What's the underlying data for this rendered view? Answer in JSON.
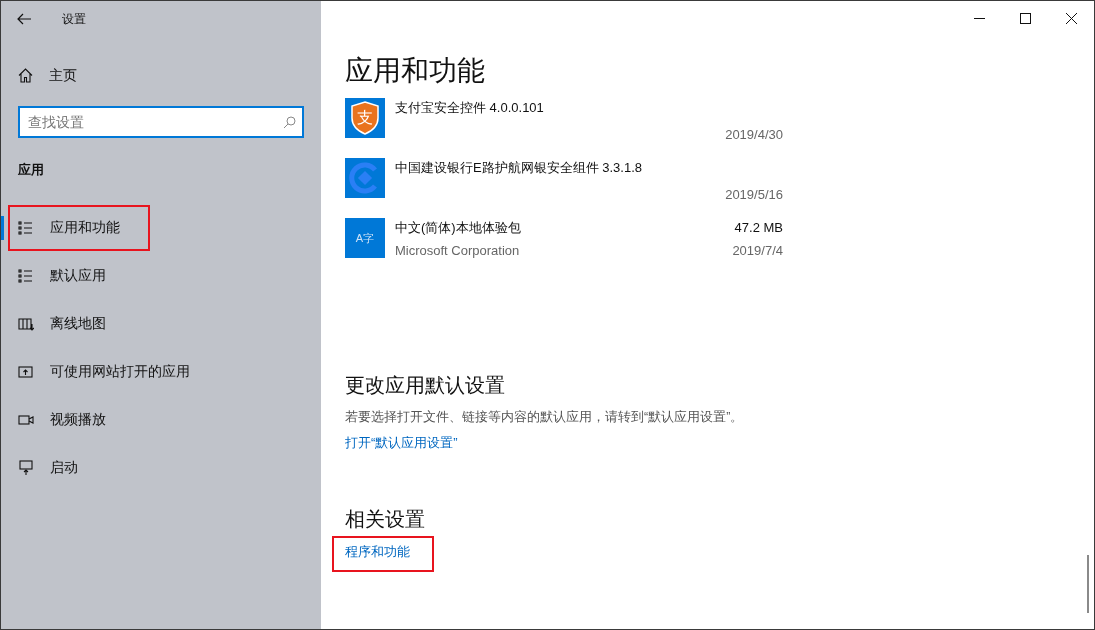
{
  "window": {
    "title": "设置"
  },
  "sidebar": {
    "home": "主页",
    "search": {
      "placeholder": "查找设置"
    },
    "section": "应用",
    "items": [
      {
        "label": "应用和功能",
        "selected": true,
        "annotated": true
      },
      {
        "label": "默认应用",
        "selected": false,
        "annotated": false
      },
      {
        "label": "离线地图",
        "selected": false,
        "annotated": false
      },
      {
        "label": "可使用网站打开的应用",
        "selected": false,
        "annotated": false
      },
      {
        "label": "视频播放",
        "selected": false,
        "annotated": false
      },
      {
        "label": "启动",
        "selected": false,
        "annotated": false
      }
    ]
  },
  "main": {
    "title": "应用和功能",
    "apps": [
      {
        "name": "支付宝安全控件 4.0.0.101",
        "icon_label": "支",
        "date": "2019/4/30"
      },
      {
        "name": "中国建设银行E路护航网银安全组件 3.3.1.8",
        "date": "2019/5/16"
      },
      {
        "name": "中文(简体)本地体验包",
        "icon_label": "A字",
        "publisher": "Microsoft Corporation",
        "size": "47.2 MB",
        "date": "2019/7/4"
      }
    ],
    "defaults": {
      "heading": "更改应用默认设置",
      "description": "若要选择打开文件、链接等内容的默认应用，请转到“默认应用设置”。",
      "link": "打开“默认应用设置”"
    },
    "related": {
      "heading": "相关设置",
      "links": [
        {
          "label": "程序和功能",
          "annotated": true
        }
      ]
    }
  }
}
